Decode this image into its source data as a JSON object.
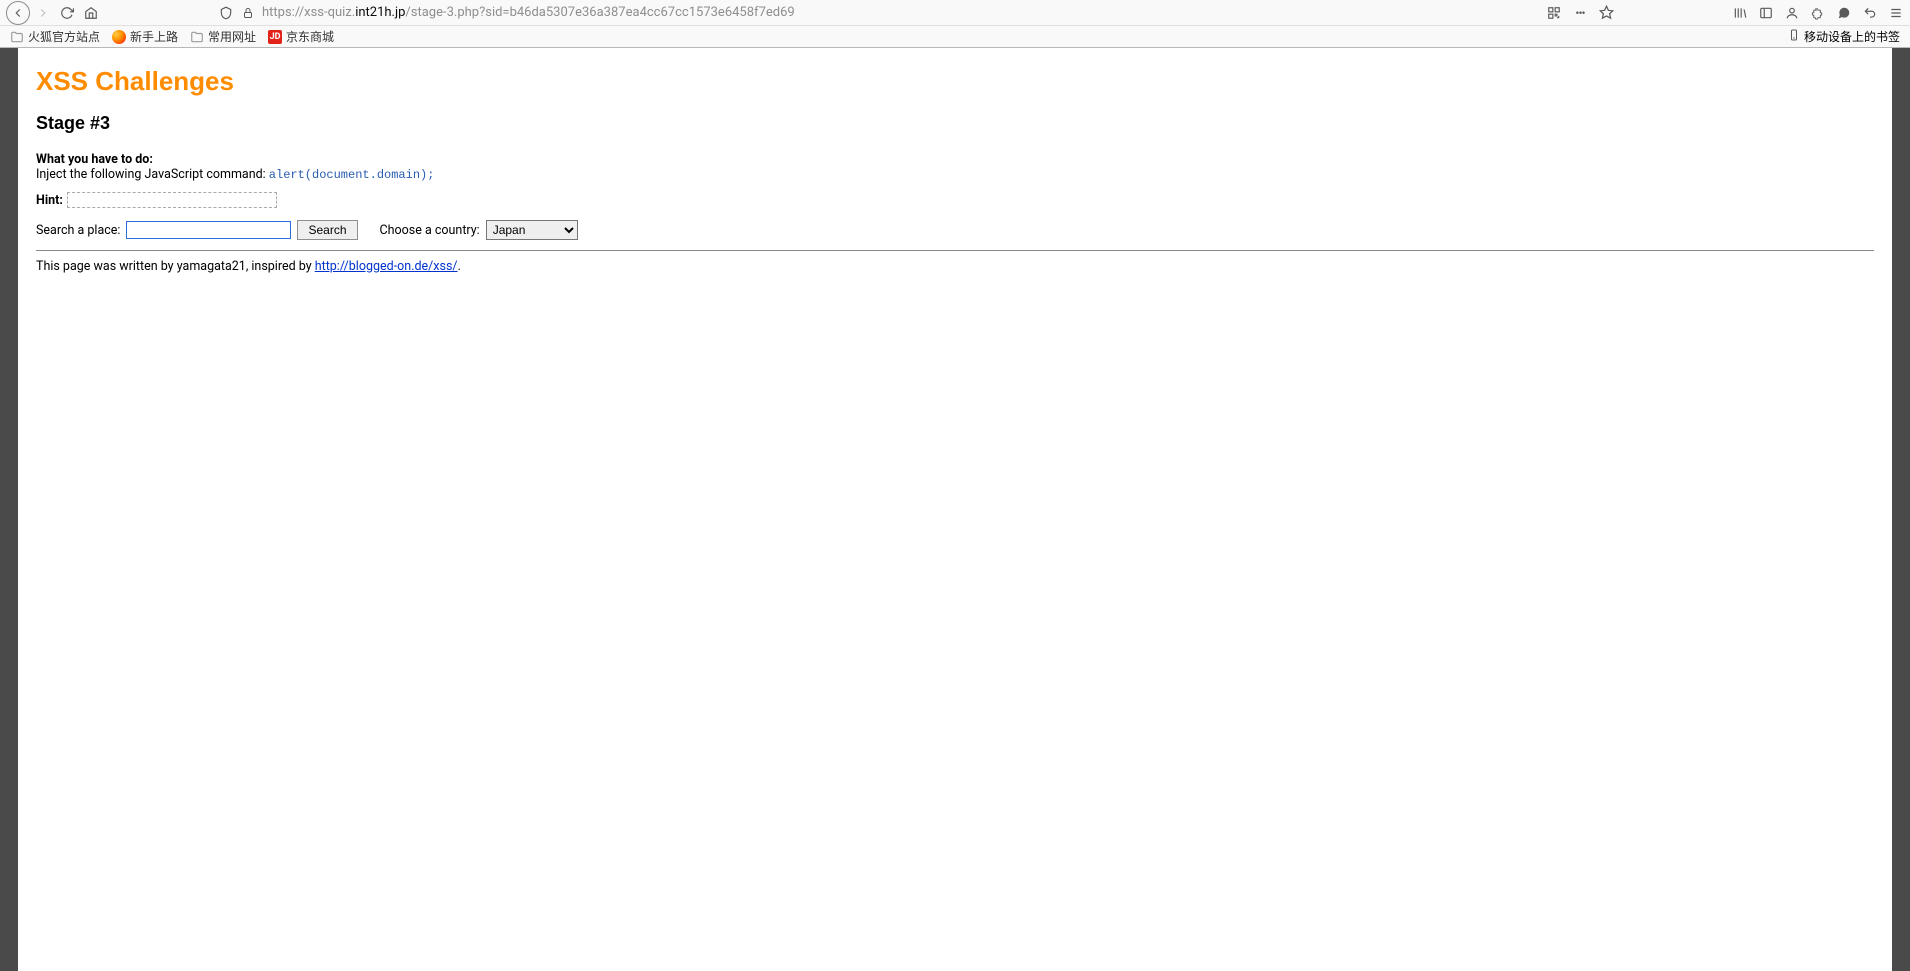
{
  "browser": {
    "url_prefix": "https://xss-quiz.",
    "url_domain": "int21h.jp",
    "url_suffix": "/stage-3.php?sid=b46da5307e36a387ea4cc67cc1573e6458f7ed69"
  },
  "bookmarks": {
    "items": [
      {
        "label": "火狐官方站点",
        "icon": "folder"
      },
      {
        "label": "新手上路",
        "icon": "firefox"
      },
      {
        "label": "常用网址",
        "icon": "folder"
      },
      {
        "label": "京东商城",
        "icon": "jd",
        "badge": "JD"
      }
    ],
    "right_label": "移动设备上的书签"
  },
  "page": {
    "title": "XSS Challenges",
    "stage": "Stage #3",
    "todo_label": "What you have to do:",
    "todo_text": "Inject the following JavaScript command: ",
    "todo_code": "alert(document.domain);",
    "hint_label": "Hint:",
    "search_label": "Search a place:",
    "search_value": "",
    "search_button": "Search",
    "country_label": "Choose a country:",
    "country_selected": "Japan",
    "footer_prefix": "This page was written by yamagata21, inspired by ",
    "footer_link_text": "http://blogged-on.de/xss/",
    "footer_suffix": "."
  }
}
